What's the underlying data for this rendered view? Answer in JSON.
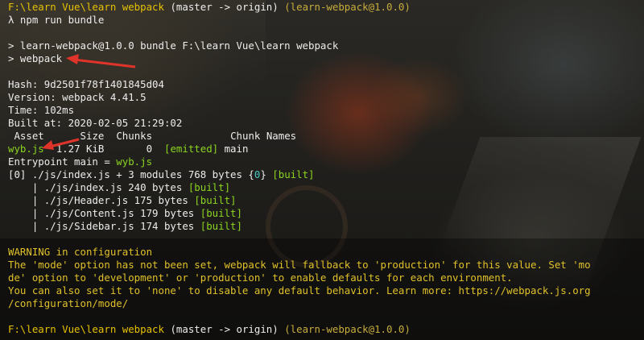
{
  "prompt1": {
    "path": "F:\\learn Vue\\learn webpack",
    "branch": "(master -> origin)",
    "pkg": "(learn-webpack@1.0.0)"
  },
  "cmd": "λ npm run bundle",
  "npm_script_line": "> learn-webpack@1.0.0 bundle F:\\learn Vue\\learn webpack",
  "npm_script_cmd": "> webpack",
  "build_info": {
    "hash": "Hash: 9d2501f78f1401845d04",
    "version": "Version: webpack 4.41.5",
    "time": "Time: 102ms",
    "built_at": "Built at: 2020-02-05 21:29:02"
  },
  "asset_table": {
    "headers": [
      "Asset",
      "Size",
      "Chunks",
      "Chunk Names"
    ],
    "rows": [
      {
        "asset": "wyb.js",
        "size": "1.27 KiB",
        "chunks": "0",
        "status": "[emitted]",
        "names": "main"
      }
    ]
  },
  "entrypoint": {
    "label": "Entrypoint main = ",
    "file": "wyb.js"
  },
  "modules": {
    "summary": {
      "id": "[0]",
      "text": "./js/index.js + 3 modules 768 bytes {",
      "chunk": "0",
      "close": "}",
      "status": "[built]"
    },
    "items": [
      {
        "prefix": "    | ",
        "name": "./js/index.js 240 bytes",
        "status": "[built]"
      },
      {
        "prefix": "    | ",
        "name": "./js/Header.js 175 bytes",
        "status": "[built]"
      },
      {
        "prefix": "    | ",
        "name": "./js/Content.js 179 bytes",
        "status": "[built]"
      },
      {
        "prefix": "    | ",
        "name": "./js/Sidebar.js 174 bytes",
        "status": "[built]"
      }
    ]
  },
  "warning": {
    "title": "WARNING in configuration",
    "line1": "The 'mode' option has not been set, webpack will fallback to 'production' for this value. Set 'mo",
    "line2": "de' option to 'development' or 'production' to enable defaults for each environment.",
    "line3": "You can also set it to 'none' to disable any default behavior. Learn more: https://webpack.js.org",
    "line4": "/configuration/mode/"
  },
  "prompt2": {
    "path": "F:\\learn Vue\\learn webpack",
    "branch": "(master -> origin)",
    "pkg": "(learn-webpack@1.0.0)"
  },
  "colors": {
    "prompt": "#e5c100",
    "built": "#8bd51f",
    "chunk_id": "#49c7c7",
    "warning": "#e0c12a",
    "annotation_arrow": "#e0342a"
  }
}
